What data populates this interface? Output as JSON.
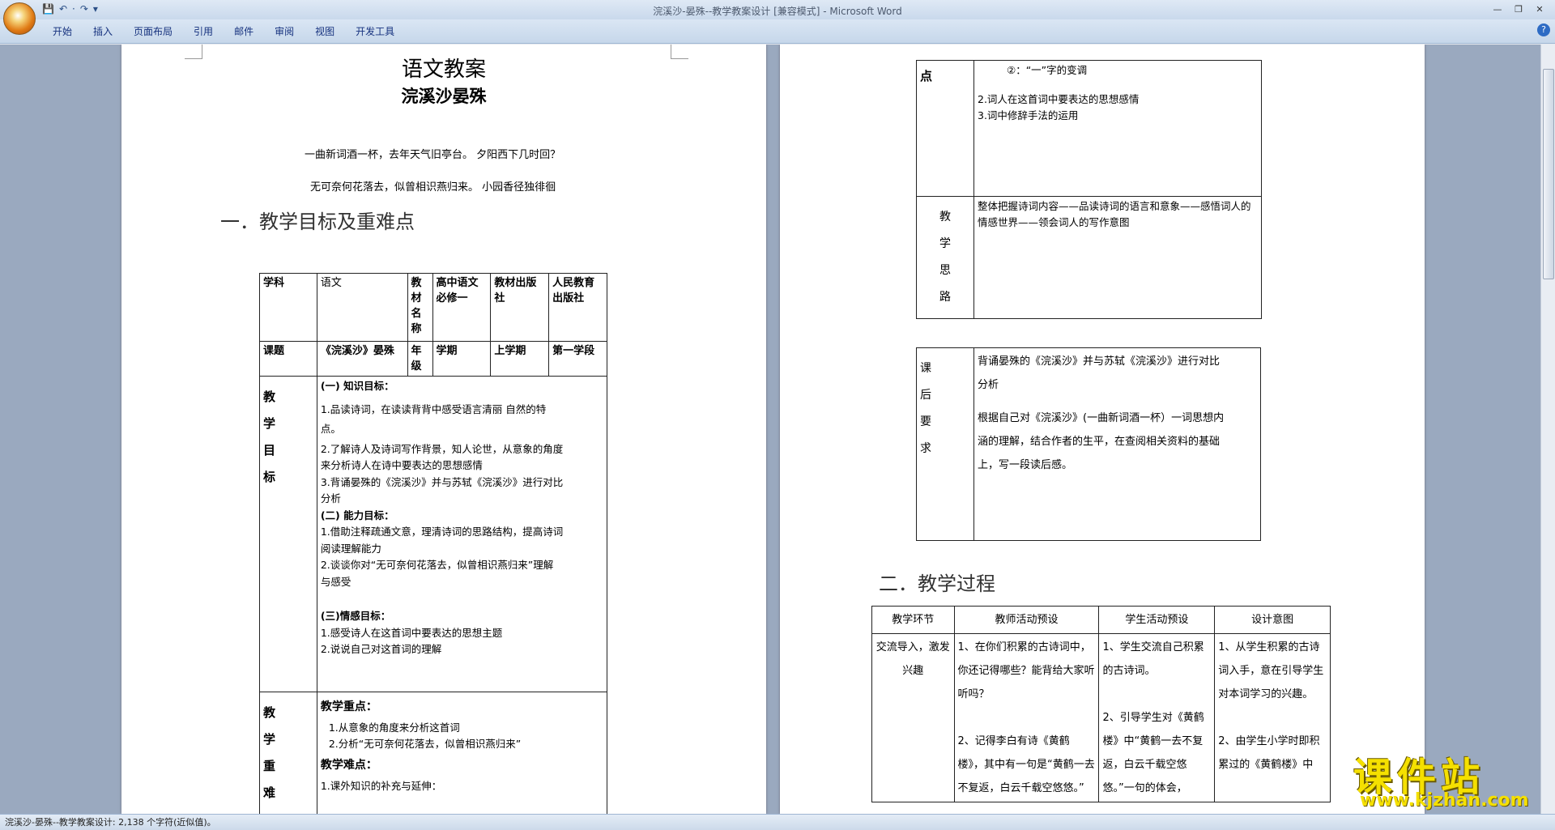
{
  "app": {
    "title": "浣溪沙-晏殊--教学教案设计 [兼容模式] - Microsoft Word",
    "qat": [
      "💾",
      "↶",
      "·",
      "↷",
      "▾"
    ],
    "controls": [
      "—",
      "❐",
      "✕"
    ],
    "help": "?"
  },
  "tabs": [
    "开始",
    "插入",
    "页面布局",
    "引用",
    "邮件",
    "审阅",
    "视图",
    "开发工具"
  ],
  "status": "浣溪沙-晏殊--教学教案设计: 2,138 个字符(近似值)。",
  "watermark": {
    "big": "课件站",
    "small": "www.kjzhan.com"
  },
  "page1": {
    "title": "语文教案",
    "subtitle": "浣溪沙晏殊",
    "poem1": "一曲新词酒一杯，去年天气旧亭台。 夕阳西下几时回？",
    "poem2": "无可奈何花落去，似曾相识燕归来。 小园香径独徘徊",
    "heading1": "一．教学目标及重难点",
    "row1": [
      "学科",
      "语文",
      "教材名称",
      "高中语文必修一",
      "教材出版社",
      "人民教育出版社"
    ],
    "row2": [
      "课题",
      "《浣溪沙》晏殊",
      "年级",
      "学期",
      "上学期",
      "第一学段"
    ],
    "goal_label": [
      "教",
      "学",
      "目",
      "标"
    ],
    "goal_lines": [
      "(一)  知识目标：",
      "1.品读诗词，在读读背背中感受语言清丽  自然的特",
      "点。",
      "2.了解诗人及诗词写作背景，知人论世，从意象的角度",
      "来分析诗人在诗中要表达的思想感情",
      "3.背诵晏殊的《浣溪沙》并与苏轼《浣溪沙》进行对比",
      "分析",
      "(二)  能力目标：",
      "1.借助注释疏通文意，理清诗词的思路结构，提高诗词",
      "阅读理解能力",
      "2.谈谈你对“无可奈何花落去，似曾相识燕归来”理解",
      "与感受",
      "",
      "(三)情感目标：",
      "1.感受诗人在这首词中要表达的思想主题",
      "2.说说自己对这首词的理解"
    ],
    "key_label": [
      "教",
      "学",
      "重",
      "难"
    ],
    "key_lines": [
      "教学重点：",
      "1.从意象的角度来分析这首词",
      "2.分析“无可奈何花落去，似曾相识燕归来”",
      "教学难点：",
      "1.课外知识的补充与延伸："
    ]
  },
  "page2": {
    "top_label": "点",
    "top_lines": [
      "②：“一”字的变调",
      "",
      "2.词人在这首词中要表达的思想感情",
      "3.词中修辞手法的运用"
    ],
    "idea_label": [
      "教",
      "学",
      "思",
      "路"
    ],
    "idea_text": "整体把握诗词内容——品读诗词的语言和意象——感悟词人的情感世界——领会词人的写作意图",
    "after_label": [
      "课",
      "后",
      "要",
      "求"
    ],
    "after_lines": [
      "背诵晏殊的《浣溪沙》并与苏轼《浣溪沙》进行对比",
      "分析",
      "",
      "根据自己对《浣溪沙》(一曲新词酒一杯）一词思想内",
      "涵的理解，结合作者的生平，在查阅相关资料的基础",
      "上，写一段读后感。"
    ],
    "heading2": "二．教学过程",
    "process_headers": [
      "教学环节",
      "教师活动预设",
      "学生活动预设",
      "设计意图"
    ],
    "process_row": [
      "交流导入，激发兴趣",
      "1、在你们积累的古诗词中，你还记得哪些？能背给大家听听吗？\n\n2、记得李白有诗《黄鹤楼》，其中有一句是“黄鹤一去不复返，白云千载空悠悠。”",
      "1、学生交流自己积累的古诗词。\n\n2、引导学生对《黄鹤楼》中“黄鹤一去不复返，白云千载空悠悠。”一句的体会，",
      "1、从学生积累的古诗词入手，意在引导学生对本词学习的兴趣。\n\n2、由学生小学时即积累过的《黄鹤楼》中"
    ]
  }
}
